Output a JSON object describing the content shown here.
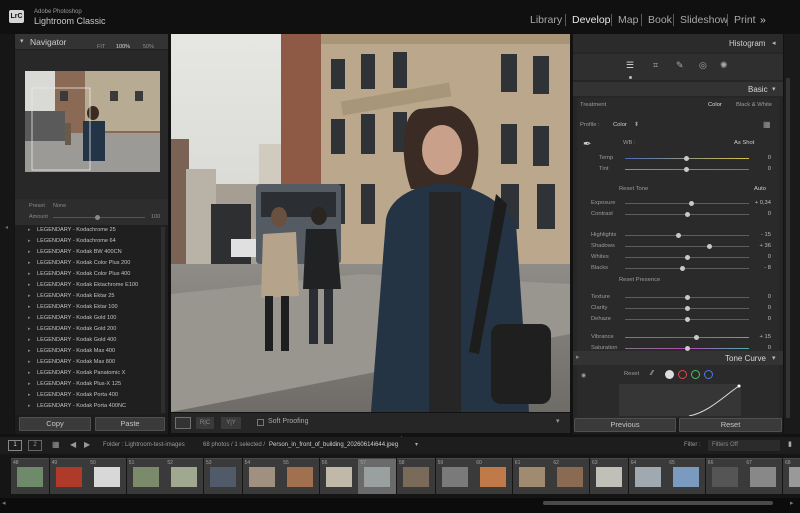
{
  "app": {
    "vendor": "Adobe Photoshop",
    "name": "Lightroom Classic",
    "logo": "LrC"
  },
  "modules": [
    "Library",
    "Develop",
    "Map",
    "Book",
    "Slideshow",
    "Print"
  ],
  "modules_more": "»",
  "navigator": {
    "title": "Navigator",
    "opts": [
      "FIT",
      "100%",
      "50%"
    ]
  },
  "preset_bar": {
    "preset_label": "Preset",
    "preset_value": "None",
    "amount_label": "Amount",
    "amount_value": "100"
  },
  "presets": [
    "LEGENDARY - Kodachrome 25",
    "LEGENDARY - Kodachrome 64",
    "LEGENDARY - Kodak BW 400CN",
    "LEGENDARY - Kodak Color Plus 200",
    "LEGENDARY - Kodak Color Plus 400",
    "LEGENDARY - Kodak Ektachrome E100",
    "LEGENDARY - Kodak Ektar 25",
    "LEGENDARY - Kodak Ektar 100",
    "LEGENDARY - Kodak Gold 100",
    "LEGENDARY - Kodak Gold 200",
    "LEGENDARY - Kodak Gold 400",
    "LEGENDARY - Kodak Max 400",
    "LEGENDARY - Kodak Max 800",
    "LEGENDARY - Kodak Panatomic X",
    "LEGENDARY - Kodak Plus-X 125",
    "LEGENDARY - Kodak Porta 400",
    "LEGENDARY - Kodak Porta 400NC"
  ],
  "left_buttons": {
    "copy": "Copy",
    "paste": "Paste"
  },
  "toolbar": {
    "soft_proofing": "Soft Proofing",
    "view_yy": "Y|Y",
    "view_rc": "R|C"
  },
  "histogram": {
    "title": "Histogram"
  },
  "basic": {
    "title": "Basic",
    "treatment_label": "Treatment",
    "treatment_color": "Color",
    "treatment_bw": "Black & White",
    "profile_label": "Profile :",
    "profile_value": "Color",
    "wb_label": "WB :",
    "wb_value": "As Shot",
    "temp_label": "Temp",
    "temp_value": "0",
    "tint_label": "Tint",
    "tint_value": "0",
    "tone_label": "Reset Tone",
    "auto_label": "Auto",
    "presence_label": "Reset Presence",
    "sliders": [
      {
        "label": "Exposure",
        "value": "+ 0,34",
        "pos": 0.54
      },
      {
        "label": "Contrast",
        "value": "0",
        "pos": 0.5
      },
      {
        "label": "Highlights",
        "value": "- 15",
        "pos": 0.43
      },
      {
        "label": "Shadows",
        "value": "+ 36",
        "pos": 0.68
      },
      {
        "label": "Whites",
        "value": "0",
        "pos": 0.5
      },
      {
        "label": "Blacks",
        "value": "- 8",
        "pos": 0.46
      },
      {
        "label": "Texture",
        "value": "0",
        "pos": 0.5
      },
      {
        "label": "Clarity",
        "value": "0",
        "pos": 0.5
      },
      {
        "label": "Dehaze",
        "value": "0",
        "pos": 0.5
      },
      {
        "label": "Vibrance",
        "value": "+ 15",
        "pos": 0.58
      },
      {
        "label": "Saturation",
        "value": "0",
        "pos": 0.5
      }
    ]
  },
  "tone_curve": {
    "title": "Tone Curve",
    "reset": "Reset"
  },
  "right_buttons": {
    "previous": "Previous",
    "reset": "Reset"
  },
  "filmbar": {
    "page1": "1",
    "page2": "2",
    "folder": "Folder : Lightroom-test-images",
    "count": "68 photos / 1 selected /",
    "filename": "Person_in_front_of_building_20260614i644.jpeg",
    "filter_label": "Filter :",
    "filter_value": "Filters Off"
  },
  "film_numbers": [
    "48",
    "49",
    "50",
    "51",
    "52",
    "53",
    "54",
    "55",
    "56",
    "57",
    "58",
    "59",
    "60",
    "61",
    "62",
    "63",
    "64",
    "65",
    "66",
    "67",
    "68"
  ],
  "colors": {
    "accent_dot1": "#e04848",
    "accent_dot2": "#4cc25c",
    "accent_dot3": "#4a7de0"
  }
}
